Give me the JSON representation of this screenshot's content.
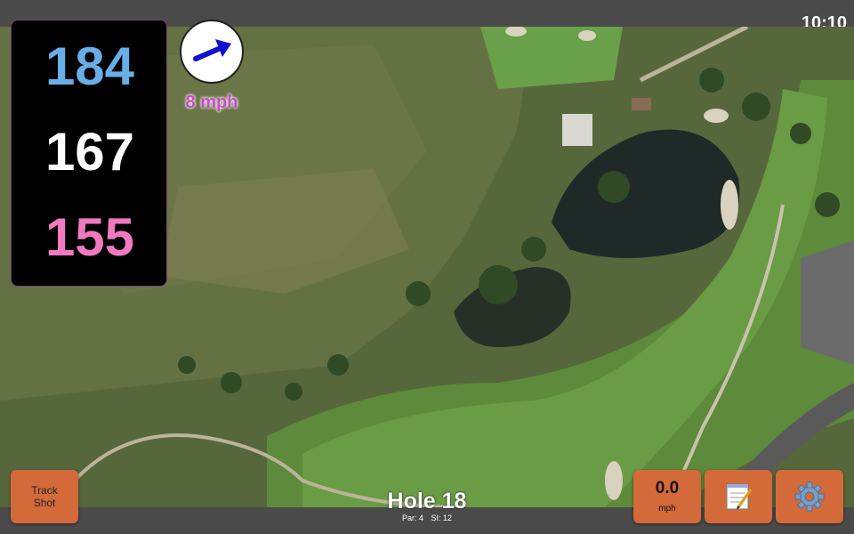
{
  "status": {
    "time": "10:10"
  },
  "distances": {
    "back": "184",
    "middle": "167",
    "front": "155",
    "colors": {
      "back": "#6aaee8",
      "middle": "#ffffff",
      "front": "#f07ac0"
    }
  },
  "wind": {
    "speed_text": "8 mph",
    "icon": "wind-arrow-icon",
    "direction": "east-northeast"
  },
  "buttons": {
    "track_shot_label": "Track\nShot",
    "speed_value": "0.0",
    "speed_unit": "mph",
    "notes_icon": "notepad-icon",
    "settings_icon": "gear-icon",
    "accent_color": "#d46a3a"
  },
  "hole": {
    "title": "Hole 18",
    "par": "Par: 4",
    "si": "SI: 12"
  }
}
